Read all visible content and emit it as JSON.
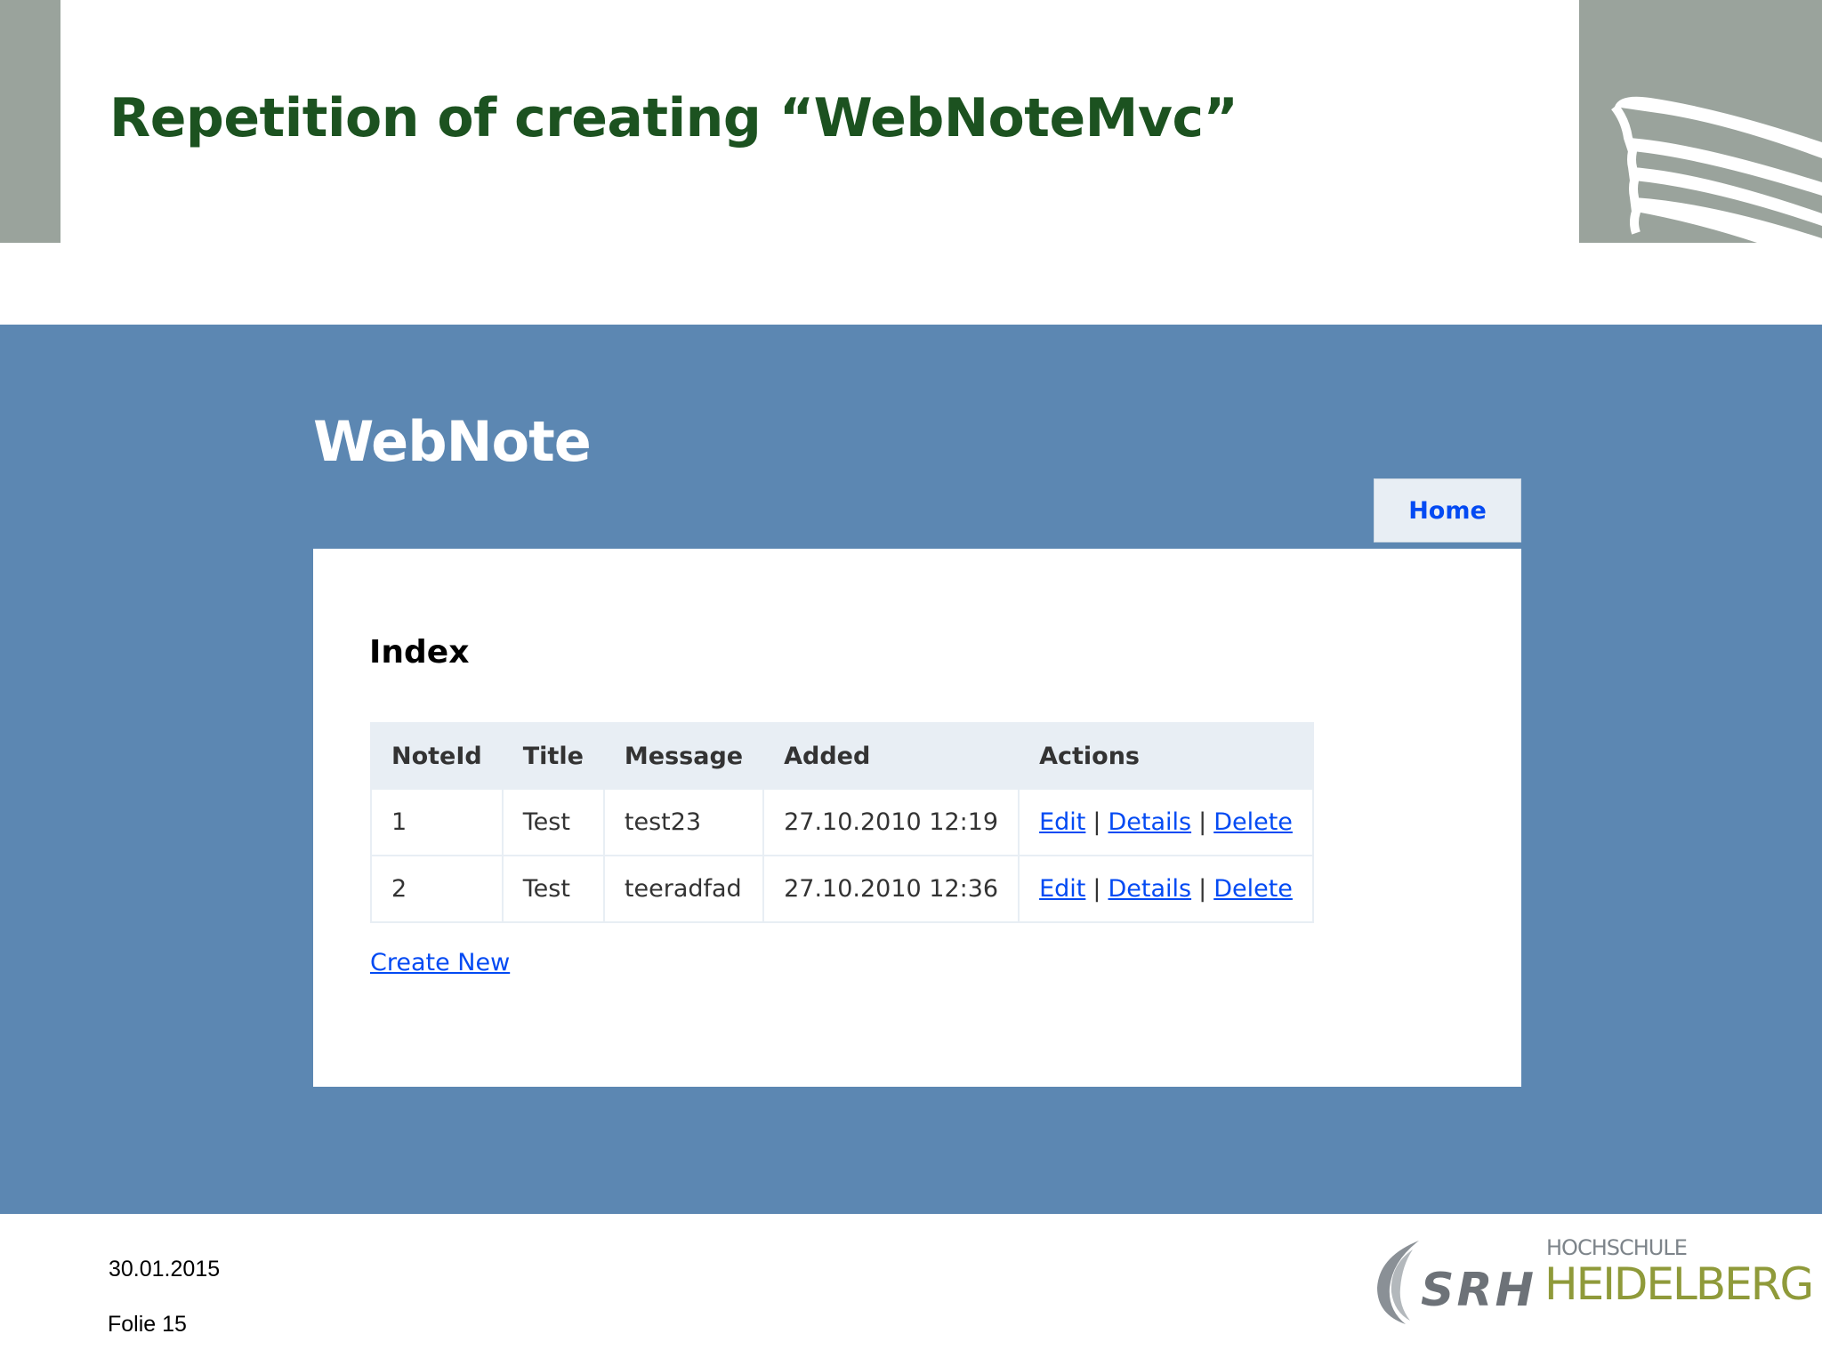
{
  "slide": {
    "title": "Repetition of creating “WebNoteMvc”",
    "date": "30.01.2015",
    "page": "Folie 15"
  },
  "app": {
    "site_title": "WebNote",
    "nav": {
      "home": "Home"
    },
    "page_heading": "Index",
    "table": {
      "headers": [
        "NoteId",
        "Title",
        "Message",
        "Added",
        "Actions"
      ],
      "rows": [
        {
          "id": "1",
          "title": "Test",
          "message": "test23",
          "added": "27.10.2010 12:19"
        },
        {
          "id": "2",
          "title": "Test",
          "message": "teeradfad",
          "added": "27.10.2010 12:36"
        }
      ],
      "actions": {
        "edit": "Edit",
        "details": "Details",
        "delete": "Delete",
        "separator": "|"
      }
    },
    "create_new": "Create New"
  },
  "logo": {
    "brand": "SRH",
    "line1": "HOCHSCHULE",
    "line2": "HEIDELBERG"
  },
  "colors": {
    "slide_title": "#1c5220",
    "header_blocks": "#9aa39c",
    "app_background": "#5c87b2",
    "link": "#034af3",
    "table_header_bg": "#e8eef4",
    "logo_green": "#8f9a3a"
  }
}
